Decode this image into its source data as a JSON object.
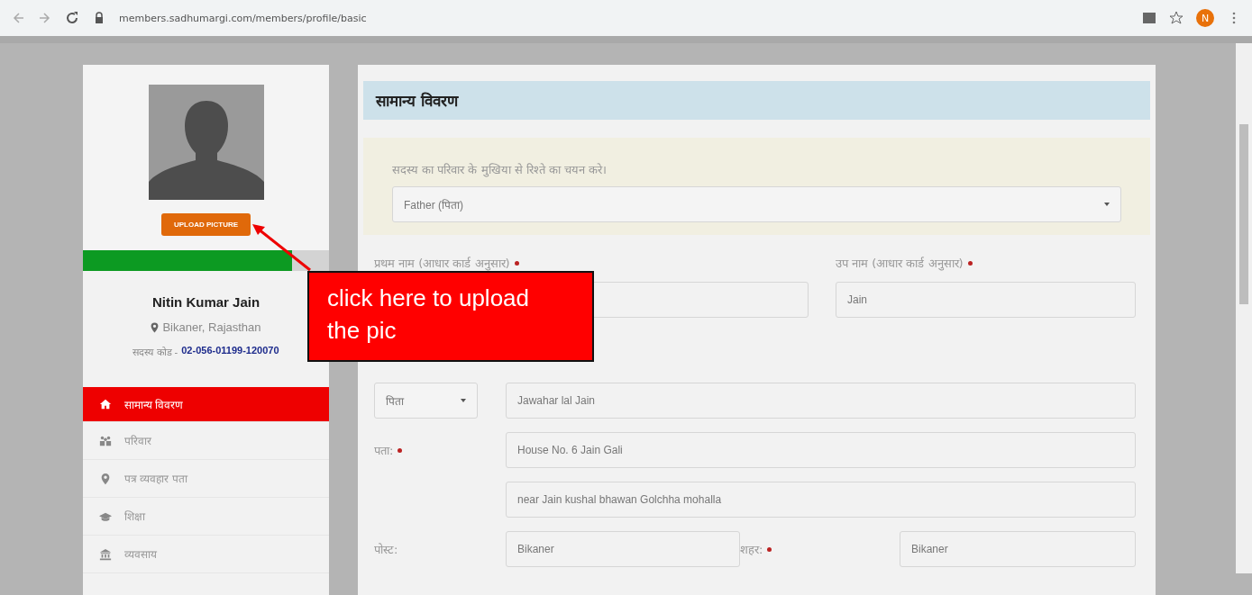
{
  "browser": {
    "url": "members.sadhumargi.com/members/profile/basic",
    "avatar_letter": "N"
  },
  "sidebar": {
    "upload_button": "UPLOAD PICTURE",
    "profile_completion": {
      "level": 0.85
    },
    "name": "Nitin Kumar Jain",
    "location": "Bikaner, Rajasthan",
    "member_code_label": "सदस्य कोड -",
    "member_code": "02-056-01199-120070",
    "menu": [
      {
        "label": "सामान्य विवरण",
        "selected": true
      },
      {
        "label": "परिवार",
        "selected": false
      },
      {
        "label": "पत्र व्यवहार पता",
        "selected": false
      },
      {
        "label": "शिक्षा",
        "selected": false
      },
      {
        "label": "व्यवसाय",
        "selected": false
      }
    ]
  },
  "form": {
    "title": "सामान्य विवरण",
    "relation": {
      "label": "सदस्य का परिवार के मुखिया से रिश्ते का चयन करे।",
      "value": "Father (पिता)"
    },
    "name_fields": [
      {
        "label": "प्रथम नाम (आधार कार्ड अनुसार)",
        "required": true
      },
      {
        "label": "उप नाम (आधार कार्ड अनुसार)",
        "required": true,
        "value": "Jain"
      }
    ],
    "guardian": {
      "relation": "पिता",
      "value": "Jawahar lal Jain"
    },
    "address": {
      "label": "पता:",
      "required": true,
      "lines": [
        "House No. 6 Jain Gali",
        "near Jain kushal bhawan Golchha mohalla"
      ]
    },
    "rows": [
      [
        {
          "label": "पोस्ट:",
          "required": false,
          "value": "Bikaner"
        },
        {
          "label": "शहर:",
          "required": true,
          "value": "Bikaner"
        }
      ]
    ]
  },
  "callout": {
    "text": "click here to upload the pic"
  }
}
